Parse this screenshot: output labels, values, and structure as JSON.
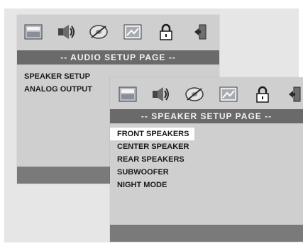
{
  "audio_menu": {
    "title": "-- AUDIO SETUP PAGE --",
    "items": [
      "SPEAKER SETUP",
      "ANALOG OUTPUT"
    ],
    "icons": [
      "general-setup-icon",
      "audio-setup-icon",
      "video-setup-icon",
      "preference-icon",
      "lock-icon",
      "exit-icon"
    ]
  },
  "speaker_menu": {
    "title": "-- SPEAKER SETUP PAGE --",
    "items": [
      "FRONT SPEAKERS",
      "CENTER SPEAKER",
      "REAR SPEAKERS",
      "SUBWOOFER",
      "NIGHT MODE"
    ],
    "selected": "FRONT SPEAKERS"
  },
  "colors": {
    "menu_background": "#cfcfcf",
    "title_bar": "#6a6a6a",
    "footer_bar": "#7a7a7a",
    "highlight": "#ffffff"
  }
}
